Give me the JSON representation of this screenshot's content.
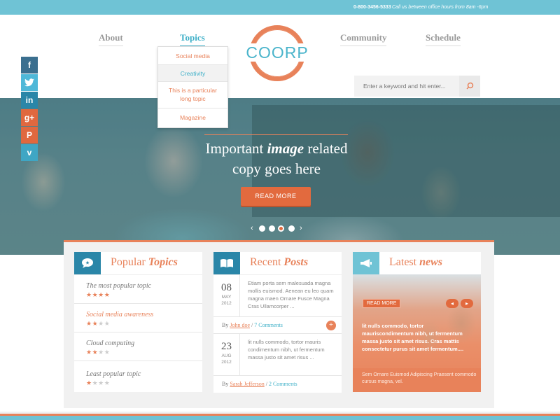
{
  "topbar": {
    "phone": "0-800-3456-5333",
    "hours": "Call us between office hours from 8am -6pm"
  },
  "nav": {
    "items": [
      "About",
      "Topics",
      "Community",
      "Schedule"
    ],
    "active": "Topics"
  },
  "topics_dropdown": [
    "Social media",
    "Creativity",
    "This is a particular long topic",
    "Magazine"
  ],
  "logo": "COORP",
  "search": {
    "placeholder": "Enter a keyword and hit enter..."
  },
  "social": [
    {
      "name": "facebook",
      "glyph": "f",
      "color": "#3b6f8f"
    },
    {
      "name": "twitter",
      "glyph": "t",
      "color": "#4fb8d8"
    },
    {
      "name": "linkedin",
      "glyph": "in",
      "color": "#2a86a8"
    },
    {
      "name": "google-plus",
      "glyph": "g+",
      "color": "#e0683f"
    },
    {
      "name": "pinterest",
      "glyph": "P",
      "color": "#e0683f"
    },
    {
      "name": "vimeo",
      "glyph": "v",
      "color": "#3fa6c4"
    }
  ],
  "hero": {
    "headline_pre": "Important ",
    "headline_em": "image",
    "headline_post": " related",
    "headline_line2": "copy goes here",
    "button": "READ MORE",
    "slides": 4,
    "active_slide": 3
  },
  "popular": {
    "title": "Popular",
    "title_em": "Topics",
    "items": [
      {
        "name": "The most popular topic",
        "stars": 4
      },
      {
        "name": "Social media awareness",
        "stars": 2
      },
      {
        "name": "Cloud computing",
        "stars": 2
      },
      {
        "name": "Least popular topic",
        "stars": 1
      }
    ]
  },
  "recent": {
    "title": "Recent",
    "title_em": "Posts",
    "posts": [
      {
        "day": "08",
        "month": "MAY",
        "year": "2012",
        "excerpt": "Etiam porta sem malesuada magna mollis euismod. Aenean eu leo quam magna maen Ornare Fusce Magna Cras Ullamcorper ...",
        "by": "By",
        "author": "John doe",
        "comments": "7 Comments"
      },
      {
        "day": "23",
        "month": "AUG",
        "year": "2012",
        "excerpt": "lit nulls commodo, tortor mauris condimentum nibh, ut fermentum massa justo sit amet risus ...",
        "by": "By",
        "author": "Sarah Jefferson",
        "comments": "2 Comments"
      }
    ]
  },
  "news": {
    "title": "Latest",
    "title_em": "news",
    "read_more": "READ MORE",
    "headline": "lit nulls commodo, tortor mauriscondimentum nibh, ut fermentum massa justo sit amet risus. Cras mattis consectetur purus sit amet fermentum....",
    "caption": "Sem Ornare Euismod Adipiscing Praesent commodo cursus magna, vel."
  },
  "colors": {
    "accent_orange": "#e8825a",
    "accent_blue": "#3fb0c8",
    "topbar": "#6fc3d5"
  }
}
